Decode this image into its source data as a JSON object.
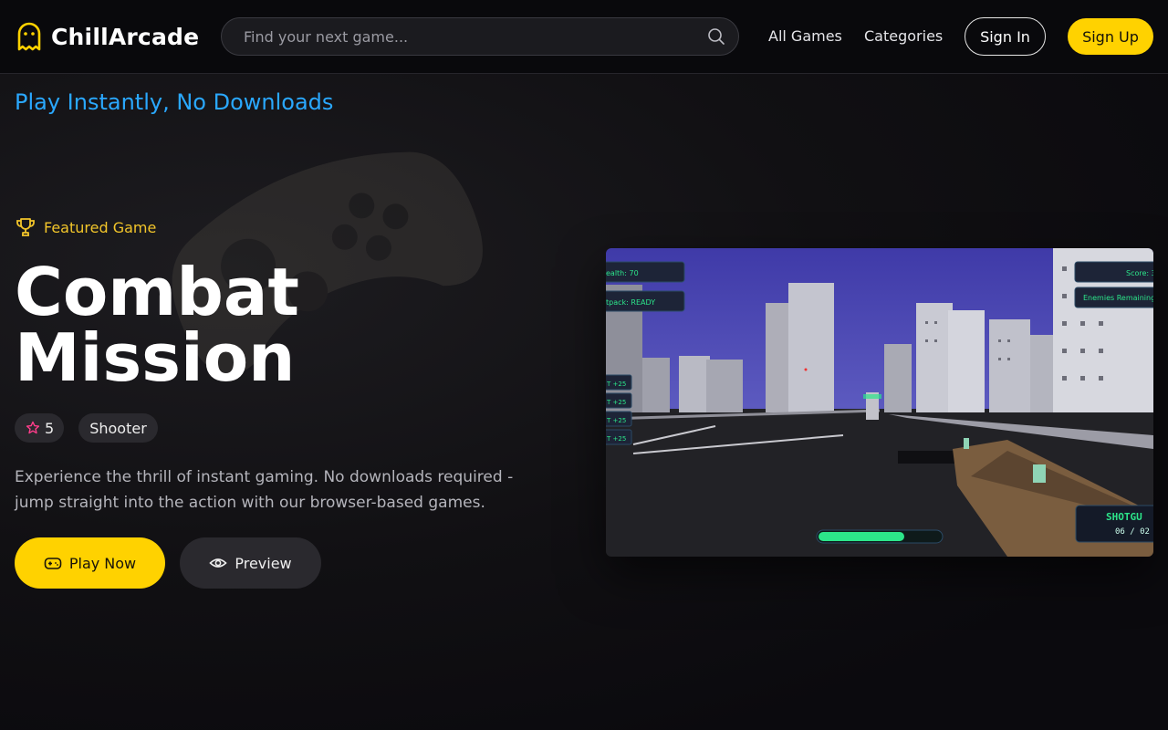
{
  "header": {
    "brand": "ChillArcade",
    "search_placeholder": "Find your next game...",
    "nav": [
      "All Games",
      "Categories"
    ],
    "sign_in": "Sign In",
    "sign_up": "Sign Up"
  },
  "hero": {
    "tagline": "Play Instantly, No Downloads",
    "featured_label": "Featured Game",
    "title_line1": "Combat",
    "title_line2": "Mission",
    "rating": "5",
    "genre": "Shooter",
    "description": "Experience the thrill of instant gaming. No downloads required - jump straight into the action with our browser-based games.",
    "play_label": "Play Now",
    "preview_label": "Preview"
  },
  "game_hud": {
    "health": "ealth: 70",
    "jetpack": "tpack: READY",
    "score": "Score: 3",
    "enemies": "Enemies Remaining:",
    "kill_feed": [
      "T +25",
      "T +25",
      "T +25",
      "T +25"
    ],
    "weapon": "SHOTGU",
    "ammo": "06 / 02"
  },
  "colors": {
    "accent": "#ffd200",
    "tagline": "#2aa8ff",
    "featured": "#f2c52a",
    "hud_text": "#2ce58a"
  }
}
